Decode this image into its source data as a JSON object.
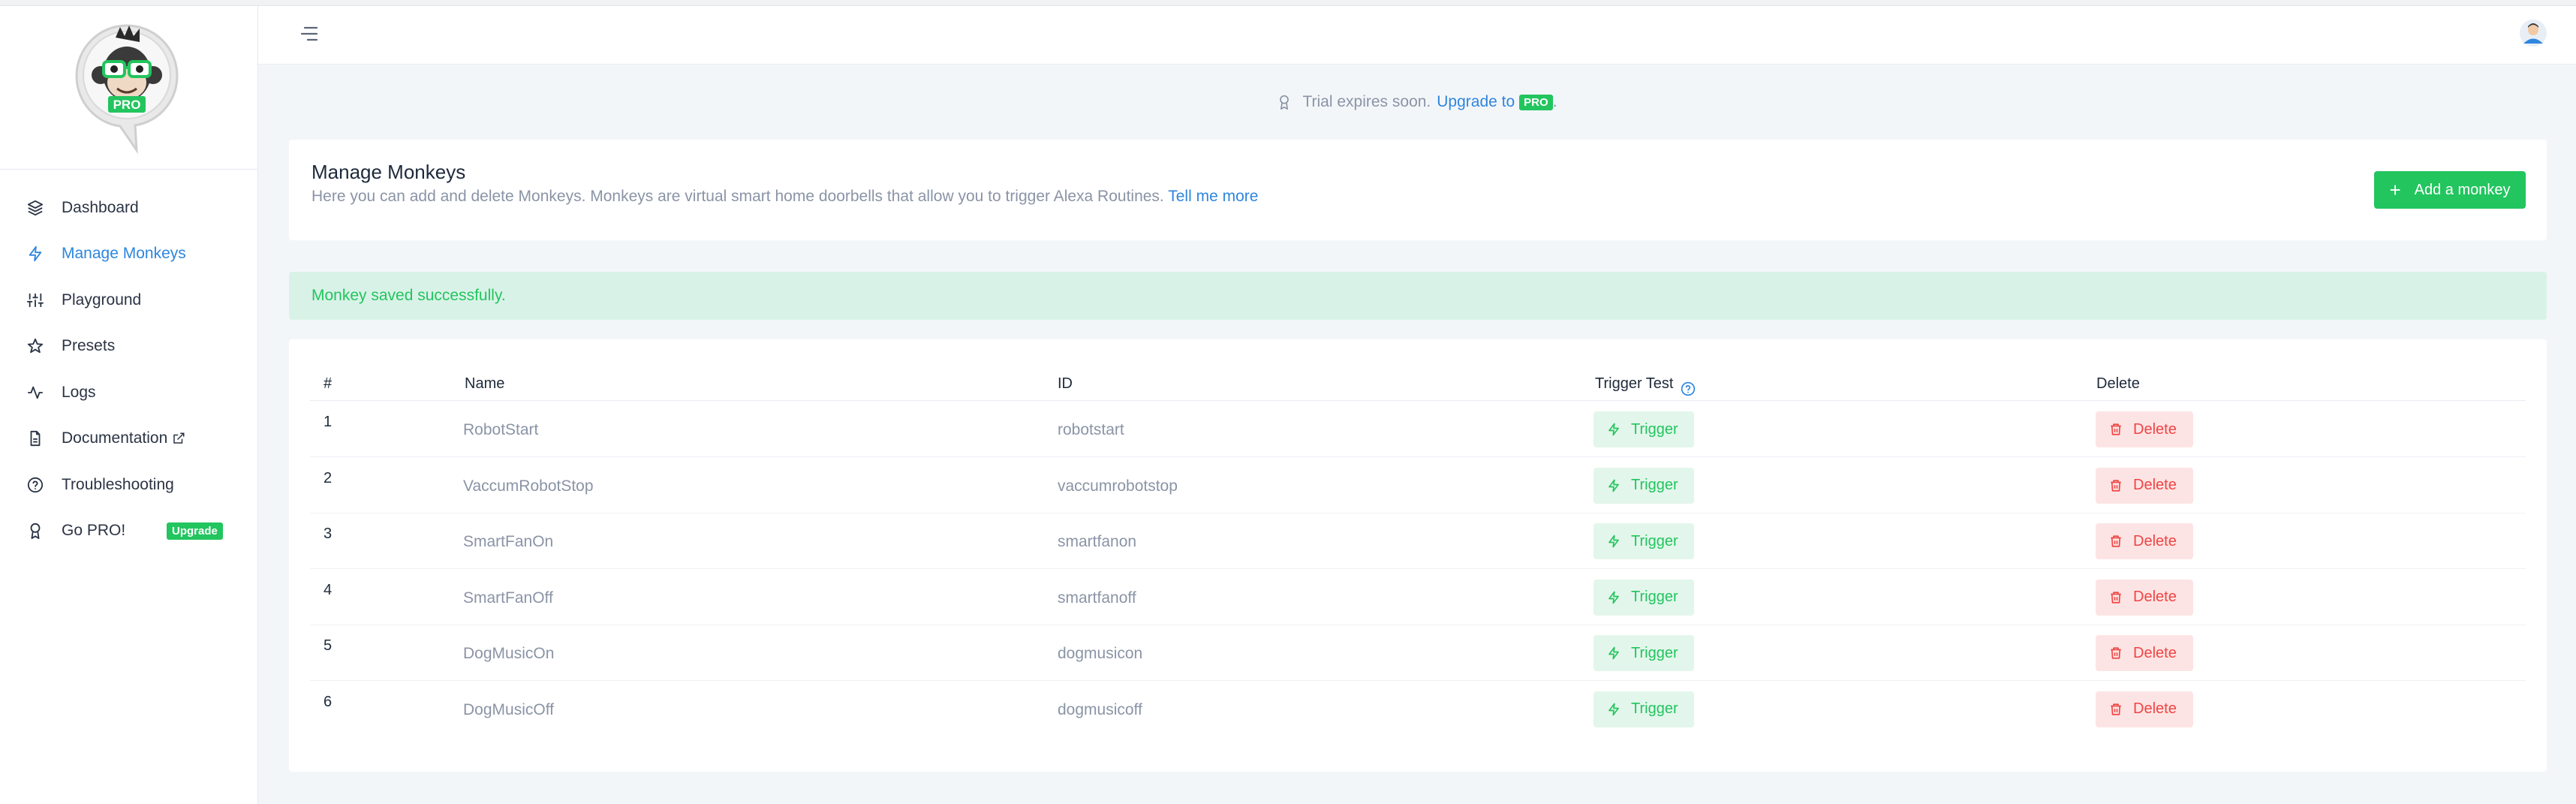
{
  "sidebar": {
    "logo_text": "PRO",
    "items": [
      {
        "label": "Dashboard",
        "icon": "layers-icon"
      },
      {
        "label": "Manage Monkeys",
        "icon": "bolt-icon",
        "active": true
      },
      {
        "label": "Playground",
        "icon": "sliders-icon"
      },
      {
        "label": "Presets",
        "icon": "star-icon"
      },
      {
        "label": "Logs",
        "icon": "activity-icon"
      },
      {
        "label": "Documentation",
        "icon": "document-icon",
        "external": true
      },
      {
        "label": "Troubleshooting",
        "icon": "help-circle-icon"
      },
      {
        "label": "Go PRO!",
        "icon": "award-icon",
        "badge": "Upgrade"
      }
    ]
  },
  "trial": {
    "text": "Trial expires soon.",
    "link": "Upgrade to",
    "pill": "PRO",
    "suffix": "."
  },
  "manage": {
    "title": "Manage Monkeys",
    "description": "Here you can add and delete Monkeys. Monkeys are virtual smart home doorbells that allow you to trigger Alexa Routines.",
    "link": "Tell me more",
    "add_button": "Add a monkey"
  },
  "alert": {
    "message": "Monkey saved successfully."
  },
  "table": {
    "headers": {
      "num": "#",
      "name": "Name",
      "id": "ID",
      "trigger": "Trigger Test",
      "delete": "Delete"
    },
    "trigger_label": "Trigger",
    "delete_label": "Delete",
    "rows": [
      {
        "num": "1",
        "name": "RobotStart",
        "id": "robotstart"
      },
      {
        "num": "2",
        "name": "VaccumRobotStop",
        "id": "vaccumrobotstop"
      },
      {
        "num": "3",
        "name": "SmartFanOn",
        "id": "smartfanon"
      },
      {
        "num": "4",
        "name": "SmartFanOff",
        "id": "smartfanoff"
      },
      {
        "num": "5",
        "name": "DogMusicOn",
        "id": "dogmusicon"
      },
      {
        "num": "6",
        "name": "DogMusicOff",
        "id": "dogmusicoff"
      }
    ]
  },
  "colors": {
    "accent": "#2e86de",
    "success": "#22c55e",
    "danger": "#ef4444",
    "background": "#f3f6f9"
  }
}
